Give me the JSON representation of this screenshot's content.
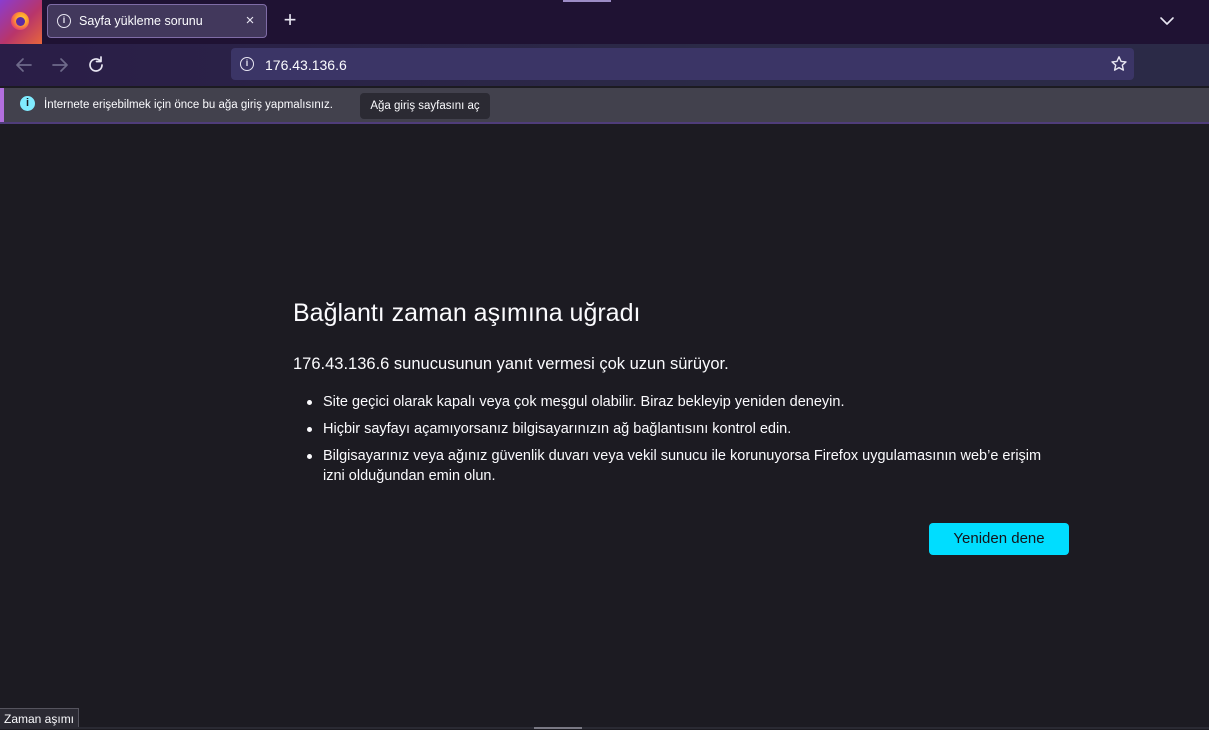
{
  "tab": {
    "title": "Sayfa yükleme sorunu",
    "icon": "info-icon",
    "close_icon": "×"
  },
  "new_tab_symbol": "+",
  "urlbar": {
    "url": "176.43.136.6"
  },
  "notification": {
    "text": "İnternete erişebilmek için önce bu ağa giriş yapmalısınız.",
    "button": "Ağa giriş sayfasını aç"
  },
  "error_page": {
    "title": "Bağlantı zaman aşımına uğradı",
    "subtitle": "176.43.136.6 sunucusunun yanıt vermesi çok uzun sürüyor.",
    "items": [
      "Site geçici olarak kapalı veya çok meşgul olabilir. Biraz bekleyip yeniden deneyin.",
      "Hiçbir sayfayı açamıyorsanız bilgisayarınızın ağ bağlantısını kontrol edin.",
      "Bilgisayarınız veya ağınız güvenlik duvarı veya vekil sunucu ile korunuyorsa Firefox uygulamasının web’e erişim izni olduğundan emin olun."
    ],
    "retry_button": "Yeniden dene"
  },
  "status_text": "Zaman aşımı",
  "colors": {
    "accent": "#00ddff",
    "notification_accent": "#b26fde",
    "page_background": "#1c1b22"
  }
}
